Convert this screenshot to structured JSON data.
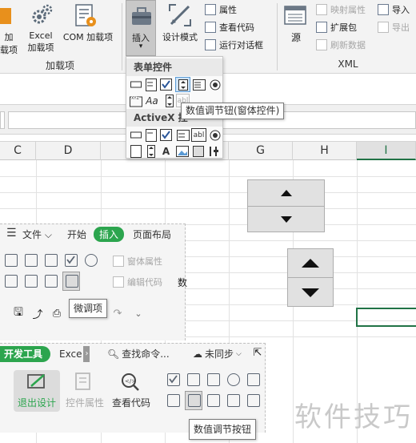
{
  "ribbon": {
    "addins": {
      "partial_label_1": "加",
      "partial_label_2": "载项",
      "excel_addins_1": "Excel",
      "excel_addins_2": "加载项",
      "com_addins": "COM 加载项",
      "group_label": "加载项"
    },
    "controls": {
      "insert_label": "插入",
      "design_mode_label": "设计模式",
      "properties": "属性",
      "view_code": "查看代码",
      "run_dialog": "运行对话框"
    },
    "xml": {
      "source": "源",
      "map_properties": "映射属性",
      "expansion_packs": "扩展包",
      "refresh_data": "刷新数据",
      "import": "导入",
      "export": "导出",
      "group_label": "XML"
    }
  },
  "insert_dropdown": {
    "form_controls_header": "表单控件",
    "activex_header": "ActiveX 控",
    "tooltip": "数值调节钮(窗体控件)"
  },
  "sheet": {
    "columns": [
      "C",
      "D",
      "E",
      "F",
      "G",
      "H",
      "I"
    ],
    "selected_column": "I"
  },
  "wps_panel_1": {
    "tabs": [
      "文件",
      "开始",
      "插入",
      "页面布局"
    ],
    "active_tab": "插入",
    "window_properties": "窗体属性",
    "edit_code": "编辑代码",
    "side_text": "数",
    "tooltip": "微调项"
  },
  "wps_panel_2": {
    "dev_tools_tab": "开发工具",
    "excel_tab": "Exce",
    "search_placeholder": "查找命令...",
    "sync_status": "未同步",
    "exit_design": "退出设计",
    "control_properties": "控件属性",
    "view_code": "查看代码",
    "tooltip": "数值调节按钮"
  },
  "watermark": "软件技巧",
  "colors": {
    "excel_green": "#217346",
    "wps_green": "#2ca54e",
    "accent_orange": "#e8901c"
  }
}
